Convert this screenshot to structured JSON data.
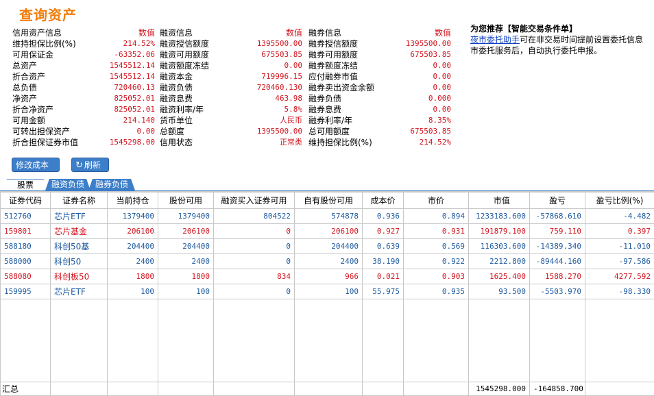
{
  "title": "查询资产",
  "info_col1": [
    {
      "label": "信用资产信息",
      "value": "数值"
    },
    {
      "label": "维持担保比例(%)",
      "value": "214.52%"
    },
    {
      "label": "可用保证金",
      "value": "-63352.06"
    },
    {
      "label": "总资产",
      "value": "1545512.14"
    },
    {
      "label": "折合资产",
      "value": "1545512.14"
    },
    {
      "label": "总负债",
      "value": "720460.13"
    },
    {
      "label": "净资产",
      "value": "825052.01"
    },
    {
      "label": "折合净资产",
      "value": "825052.01"
    },
    {
      "label": "可用金额",
      "value": "214.140"
    },
    {
      "label": "可转出担保资产",
      "value": "0.00"
    },
    {
      "label": "折合担保证券市值",
      "value": "1545298.00"
    }
  ],
  "info_col2": [
    {
      "label": "融资信息",
      "value": "数值"
    },
    {
      "label": "融资授信额度",
      "value": "1395500.00"
    },
    {
      "label": "融资可用额度",
      "value": "675503.85"
    },
    {
      "label": "融资额度冻结",
      "value": "0.00"
    },
    {
      "label": "融资本金",
      "value": "719996.15"
    },
    {
      "label": "融资负债",
      "value": "720460.130"
    },
    {
      "label": "融资息费",
      "value": "463.98"
    },
    {
      "label": "融资利率/年",
      "value": "5.8%"
    },
    {
      "label": "货币单位",
      "value": "人民币"
    },
    {
      "label": "总额度",
      "value": "1395500.00"
    },
    {
      "label": "信用状态",
      "value": "正常类"
    }
  ],
  "info_col3": [
    {
      "label": "融券信息",
      "value": "数值"
    },
    {
      "label": "融券授信额度",
      "value": "1395500.00"
    },
    {
      "label": "融券可用额度",
      "value": "675503.85"
    },
    {
      "label": "融券额度冻结",
      "value": "0.00"
    },
    {
      "label": "应付融券市值",
      "value": "0.00"
    },
    {
      "label": "融券卖出资金余额",
      "value": "0.00"
    },
    {
      "label": "融券负债",
      "value": "0.000"
    },
    {
      "label": "融券息费",
      "value": "0.00"
    },
    {
      "label": "融券利率/年",
      "value": "8.35%"
    },
    {
      "label": "总可用额度",
      "value": "675503.85"
    },
    {
      "label": "维持担保比例(%)",
      "value": "214.52%"
    }
  ],
  "promo": {
    "title": "为您推荐【智能交易条件单】",
    "link": "夜市委托助手",
    "text1": "可在非交易时间提前设置委托信息",
    "text2": "市委托服务后，自动执行委托申报。"
  },
  "buttons": {
    "edit_cost": "修改成本价",
    "refresh": "刷新"
  },
  "tabs": [
    "股票",
    "融资负债",
    "融券负债"
  ],
  "table": {
    "headers": [
      "证券代码",
      "证券名称",
      "当前持仓",
      "股份可用",
      "融资买入证券可用",
      "自有股份可用",
      "成本价",
      "市价",
      "市值",
      "盈亏",
      "盈亏比例(%)"
    ],
    "rows": [
      {
        "color": "blue",
        "cells": [
          "512760",
          "芯片ETF",
          "1379400",
          "1379400",
          "804522",
          "574878",
          "0.936",
          "0.894",
          "1233183.600",
          "-57868.610",
          "-4.482"
        ]
      },
      {
        "color": "red",
        "cells": [
          "159801",
          "芯片基金",
          "206100",
          "206100",
          "0",
          "206100",
          "0.927",
          "0.931",
          "191879.100",
          "759.110",
          "0.397"
        ]
      },
      {
        "color": "blue",
        "cells": [
          "588180",
          "科创50基",
          "204400",
          "204400",
          "0",
          "204400",
          "0.639",
          "0.569",
          "116303.600",
          "-14389.340",
          "-11.010"
        ]
      },
      {
        "color": "blue",
        "cells": [
          "588000",
          "科创50",
          "2400",
          "2400",
          "0",
          "2400",
          "38.190",
          "0.922",
          "2212.800",
          "-89444.160",
          "-97.586"
        ]
      },
      {
        "color": "red",
        "cells": [
          "588080",
          "科创板50",
          "1800",
          "1800",
          "834",
          "966",
          "0.021",
          "0.903",
          "1625.400",
          "1588.270",
          "4277.592"
        ]
      },
      {
        "color": "blue",
        "cells": [
          "159995",
          "芯片ETF",
          "100",
          "100",
          "0",
          "100",
          "55.975",
          "0.935",
          "93.500",
          "-5503.970",
          "-98.330"
        ]
      }
    ],
    "total": {
      "label": "汇总",
      "market_value": "1545298.000",
      "pnl": "-164858.700"
    }
  },
  "colors": {
    "accent": "#3d7ec9",
    "title": "#f07d0a",
    "up": "#d2141e",
    "down": "#1e5aa0"
  }
}
